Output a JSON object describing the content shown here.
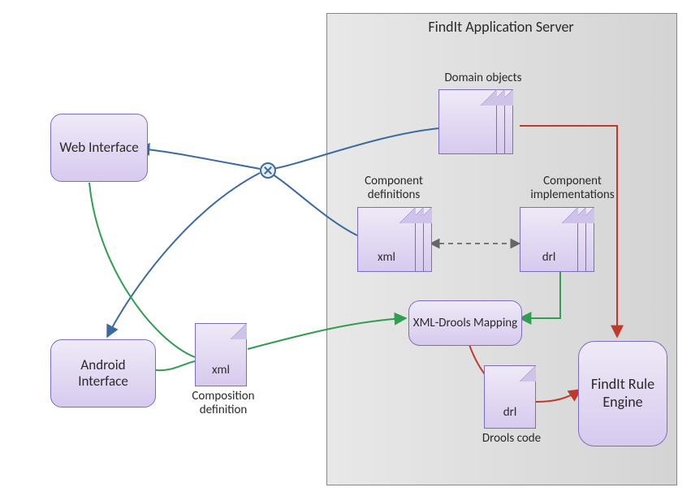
{
  "server_title": "FindIt Application Server",
  "nodes": {
    "web_interface": "Web Interface",
    "android_interface": "Android Interface",
    "xml_drools_mapping": "XML-Drools Mapping",
    "findit_rule_engine": "FindIt Rule Engine"
  },
  "docs": {
    "domain_objects": {
      "caption": "Domain objects",
      "text": ""
    },
    "component_definitions": {
      "caption": "Component definitions",
      "text": "xml"
    },
    "component_implementations": {
      "caption": "Component implementations",
      "text": "drl"
    },
    "composition_definition": {
      "caption": "Composition definition",
      "text": "xml"
    },
    "drools_code": {
      "caption": "Drools code",
      "text": "drl"
    }
  },
  "chart_data": {
    "type": "flow-diagram",
    "container": {
      "id": "findit_app_server",
      "label": "FindIt Application Server",
      "contains": [
        "domain_objects",
        "component_definitions",
        "component_implementations",
        "xml_drools_mapping",
        "drools_code",
        "findit_rule_engine"
      ]
    },
    "nodes": [
      {
        "id": "web_interface",
        "label": "Web Interface",
        "kind": "process"
      },
      {
        "id": "android_interface",
        "label": "Android Interface",
        "kind": "process"
      },
      {
        "id": "composition_definition",
        "label": "Composition definition",
        "kind": "document",
        "format": "xml"
      },
      {
        "id": "junction",
        "label": "",
        "kind": "merge"
      },
      {
        "id": "domain_objects",
        "label": "Domain objects",
        "kind": "document-stack"
      },
      {
        "id": "component_definitions",
        "label": "Component definitions",
        "kind": "document-stack",
        "format": "xml"
      },
      {
        "id": "component_implementations",
        "label": "Component implementations",
        "kind": "document-stack",
        "format": "drl"
      },
      {
        "id": "xml_drools_mapping",
        "label": "XML-Drools Mapping",
        "kind": "process"
      },
      {
        "id": "drools_code",
        "label": "Drools code",
        "kind": "document",
        "format": "drl"
      },
      {
        "id": "findit_rule_engine",
        "label": "FindIt Rule Engine",
        "kind": "process"
      }
    ],
    "edges": [
      {
        "from": "domain_objects",
        "to": "junction",
        "color": "blue",
        "style": "solid"
      },
      {
        "from": "component_definitions",
        "to": "junction",
        "color": "blue",
        "style": "solid"
      },
      {
        "from": "junction",
        "to": "web_interface",
        "color": "blue",
        "style": "solid",
        "arrow": "to"
      },
      {
        "from": "junction",
        "to": "android_interface",
        "color": "blue",
        "style": "solid",
        "arrow": "to"
      },
      {
        "from": "component_definitions",
        "to": "component_implementations",
        "color": "gray",
        "style": "dashed",
        "arrow": "both"
      },
      {
        "from": "web_interface",
        "to": "composition_definition",
        "color": "green",
        "style": "solid"
      },
      {
        "from": "android_interface",
        "to": "composition_definition",
        "color": "green",
        "style": "solid"
      },
      {
        "from": "composition_definition",
        "to": "xml_drools_mapping",
        "color": "green",
        "style": "solid",
        "arrow": "to"
      },
      {
        "from": "component_implementations",
        "to": "xml_drools_mapping",
        "color": "green",
        "style": "solid",
        "arrow": "to"
      },
      {
        "from": "xml_drools_mapping",
        "to": "drools_code",
        "color": "red",
        "style": "solid"
      },
      {
        "from": "drools_code",
        "to": "findit_rule_engine",
        "color": "red",
        "style": "solid",
        "arrow": "to"
      },
      {
        "from": "domain_objects",
        "to": "findit_rule_engine",
        "color": "red",
        "style": "solid",
        "arrow": "to"
      }
    ]
  }
}
